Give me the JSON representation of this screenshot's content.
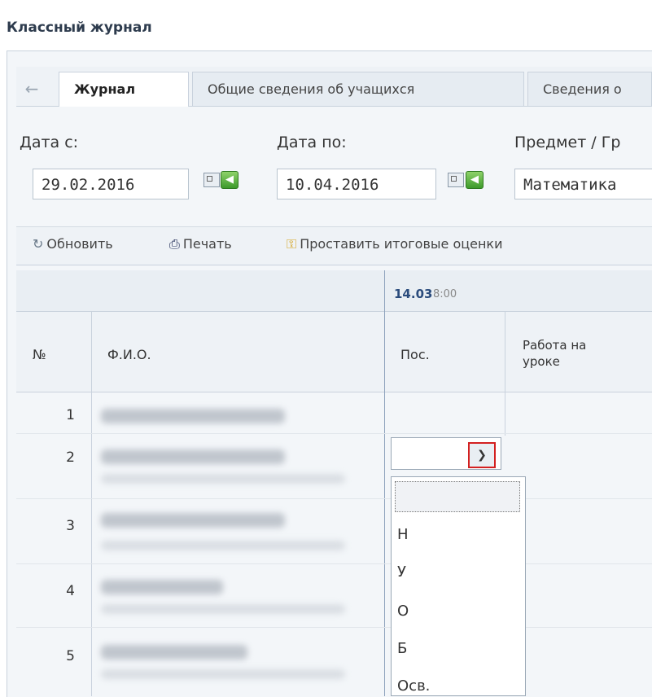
{
  "window_title": "Классный журнал",
  "tabs": [
    {
      "label": "Журнал",
      "active": true
    },
    {
      "label": "Общие сведения об учащихся",
      "active": false
    },
    {
      "label": "Сведения о",
      "active": false
    }
  ],
  "filters": {
    "date_from_label": "Дата с:",
    "date_from_value": "29.02.2016",
    "date_to_label": "Дата по:",
    "date_to_value": "10.04.2016",
    "subject_label": "Предмет / Гр",
    "subject_value": "Математика"
  },
  "toolbar": {
    "refresh_label": "Обновить",
    "print_label": "Печать",
    "final_grades_label": "Проставить итоговые оценки"
  },
  "grid": {
    "lesson_date": "14.03",
    "lesson_time": "8:00",
    "col_num": "№",
    "col_name": "Ф.И.О.",
    "col_attendance": "Пос.",
    "col_work_line1": "Работа на",
    "col_work_line2": "уроке",
    "rows": [
      "1",
      "2",
      "3",
      "4",
      "5"
    ]
  },
  "attendance_options": [
    "",
    "Н",
    "У",
    "О",
    "Б",
    "Осв."
  ],
  "colors": {
    "highlight": "#d32020",
    "header_bg": "#eef2f6",
    "border": "#c9d2dd"
  }
}
